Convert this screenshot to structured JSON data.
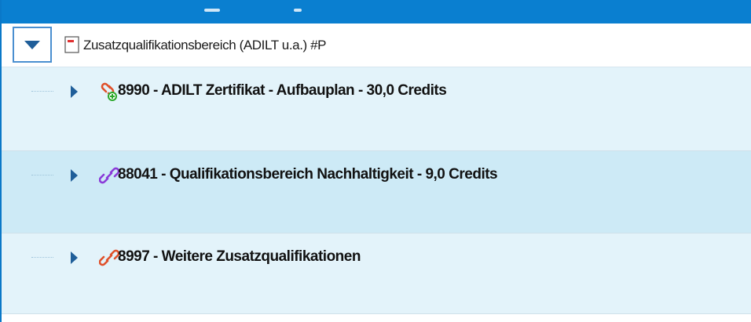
{
  "header": {
    "label": "Zusatzqualifikationsbereich (ADILT u.a.) #P",
    "expander_icon": "chevron-down-icon",
    "page_icon": "document-icon"
  },
  "colors": {
    "accent": "#0a7fd0",
    "row_light": "#e3f3fa",
    "row_selected": "#cdeaf6",
    "icon_red": "#e0502a",
    "icon_purple": "#8a3ad8",
    "icon_green": "#2aa82a"
  },
  "tree": {
    "items": [
      {
        "label": "8990 - ADILT Zertifikat - Aufbauplan - 30,0 Credits",
        "icon": "link-add-icon"
      },
      {
        "label": "88041 - Qualifikationsbereich Nachhaltigkeit - 9,0 Credits",
        "icon": "link-icon"
      },
      {
        "label": "8997 - Weitere Zusatzqualifikationen",
        "icon": "link-icon"
      }
    ]
  }
}
